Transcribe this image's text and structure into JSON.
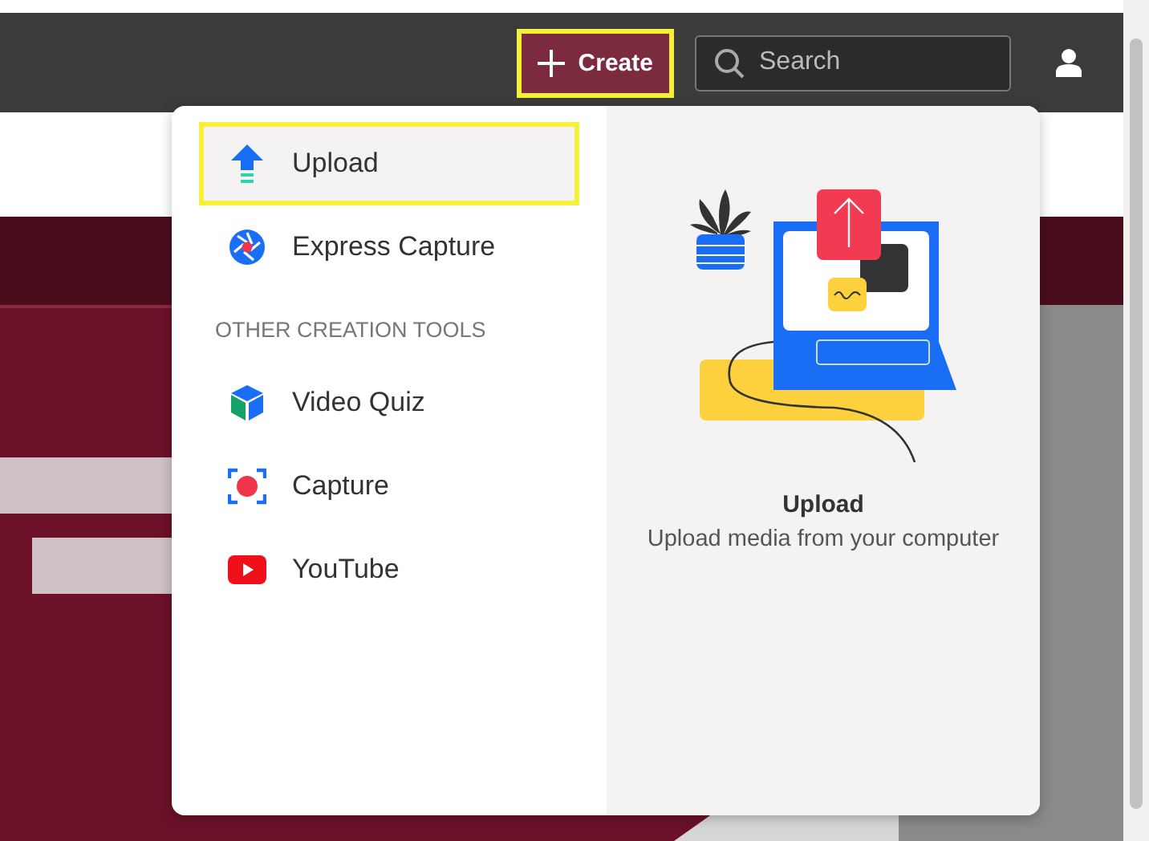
{
  "header": {
    "create_button": {
      "label": "Create",
      "highlighted": true
    },
    "search": {
      "placeholder": "Search"
    }
  },
  "create_menu": {
    "items": [
      {
        "kind": "item",
        "label": "Upload",
        "selected": true,
        "highlighted": true
      },
      {
        "kind": "item",
        "label": "Express Capture",
        "selected": false,
        "highlighted": false
      },
      {
        "kind": "heading",
        "label": "OTHER CREATION TOOLS"
      },
      {
        "kind": "item",
        "label": "Video Quiz",
        "selected": false,
        "highlighted": false
      },
      {
        "kind": "item",
        "label": "Capture",
        "selected": false,
        "highlighted": false
      },
      {
        "kind": "item",
        "label": "YouTube",
        "selected": false,
        "highlighted": false
      }
    ],
    "preview": {
      "title": "Upload",
      "description": "Upload media from your computer"
    }
  }
}
